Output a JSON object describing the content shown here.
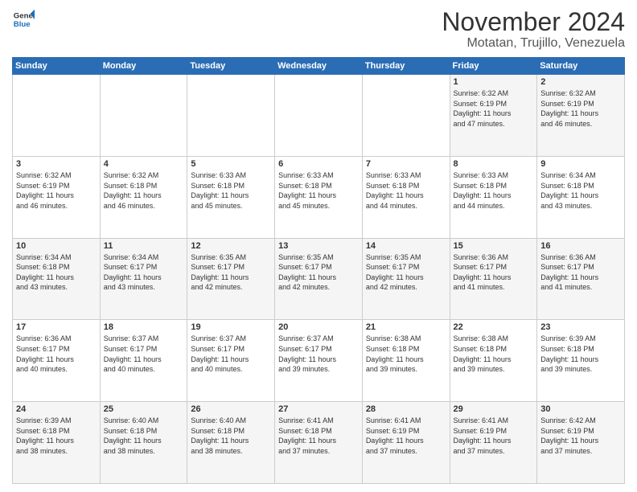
{
  "header": {
    "logo_general": "General",
    "logo_blue": "Blue",
    "title": "November 2024",
    "location": "Motatan, Trujillo, Venezuela"
  },
  "weekdays": [
    "Sunday",
    "Monday",
    "Tuesday",
    "Wednesday",
    "Thursday",
    "Friday",
    "Saturday"
  ],
  "weeks": [
    [
      {
        "day": "",
        "info": ""
      },
      {
        "day": "",
        "info": ""
      },
      {
        "day": "",
        "info": ""
      },
      {
        "day": "",
        "info": ""
      },
      {
        "day": "",
        "info": ""
      },
      {
        "day": "1",
        "info": "Sunrise: 6:32 AM\nSunset: 6:19 PM\nDaylight: 11 hours\nand 47 minutes."
      },
      {
        "day": "2",
        "info": "Sunrise: 6:32 AM\nSunset: 6:19 PM\nDaylight: 11 hours\nand 46 minutes."
      }
    ],
    [
      {
        "day": "3",
        "info": "Sunrise: 6:32 AM\nSunset: 6:19 PM\nDaylight: 11 hours\nand 46 minutes."
      },
      {
        "day": "4",
        "info": "Sunrise: 6:32 AM\nSunset: 6:18 PM\nDaylight: 11 hours\nand 46 minutes."
      },
      {
        "day": "5",
        "info": "Sunrise: 6:33 AM\nSunset: 6:18 PM\nDaylight: 11 hours\nand 45 minutes."
      },
      {
        "day": "6",
        "info": "Sunrise: 6:33 AM\nSunset: 6:18 PM\nDaylight: 11 hours\nand 45 minutes."
      },
      {
        "day": "7",
        "info": "Sunrise: 6:33 AM\nSunset: 6:18 PM\nDaylight: 11 hours\nand 44 minutes."
      },
      {
        "day": "8",
        "info": "Sunrise: 6:33 AM\nSunset: 6:18 PM\nDaylight: 11 hours\nand 44 minutes."
      },
      {
        "day": "9",
        "info": "Sunrise: 6:34 AM\nSunset: 6:18 PM\nDaylight: 11 hours\nand 43 minutes."
      }
    ],
    [
      {
        "day": "10",
        "info": "Sunrise: 6:34 AM\nSunset: 6:18 PM\nDaylight: 11 hours\nand 43 minutes."
      },
      {
        "day": "11",
        "info": "Sunrise: 6:34 AM\nSunset: 6:17 PM\nDaylight: 11 hours\nand 43 minutes."
      },
      {
        "day": "12",
        "info": "Sunrise: 6:35 AM\nSunset: 6:17 PM\nDaylight: 11 hours\nand 42 minutes."
      },
      {
        "day": "13",
        "info": "Sunrise: 6:35 AM\nSunset: 6:17 PM\nDaylight: 11 hours\nand 42 minutes."
      },
      {
        "day": "14",
        "info": "Sunrise: 6:35 AM\nSunset: 6:17 PM\nDaylight: 11 hours\nand 42 minutes."
      },
      {
        "day": "15",
        "info": "Sunrise: 6:36 AM\nSunset: 6:17 PM\nDaylight: 11 hours\nand 41 minutes."
      },
      {
        "day": "16",
        "info": "Sunrise: 6:36 AM\nSunset: 6:17 PM\nDaylight: 11 hours\nand 41 minutes."
      }
    ],
    [
      {
        "day": "17",
        "info": "Sunrise: 6:36 AM\nSunset: 6:17 PM\nDaylight: 11 hours\nand 40 minutes."
      },
      {
        "day": "18",
        "info": "Sunrise: 6:37 AM\nSunset: 6:17 PM\nDaylight: 11 hours\nand 40 minutes."
      },
      {
        "day": "19",
        "info": "Sunrise: 6:37 AM\nSunset: 6:17 PM\nDaylight: 11 hours\nand 40 minutes."
      },
      {
        "day": "20",
        "info": "Sunrise: 6:37 AM\nSunset: 6:17 PM\nDaylight: 11 hours\nand 39 minutes."
      },
      {
        "day": "21",
        "info": "Sunrise: 6:38 AM\nSunset: 6:18 PM\nDaylight: 11 hours\nand 39 minutes."
      },
      {
        "day": "22",
        "info": "Sunrise: 6:38 AM\nSunset: 6:18 PM\nDaylight: 11 hours\nand 39 minutes."
      },
      {
        "day": "23",
        "info": "Sunrise: 6:39 AM\nSunset: 6:18 PM\nDaylight: 11 hours\nand 39 minutes."
      }
    ],
    [
      {
        "day": "24",
        "info": "Sunrise: 6:39 AM\nSunset: 6:18 PM\nDaylight: 11 hours\nand 38 minutes."
      },
      {
        "day": "25",
        "info": "Sunrise: 6:40 AM\nSunset: 6:18 PM\nDaylight: 11 hours\nand 38 minutes."
      },
      {
        "day": "26",
        "info": "Sunrise: 6:40 AM\nSunset: 6:18 PM\nDaylight: 11 hours\nand 38 minutes."
      },
      {
        "day": "27",
        "info": "Sunrise: 6:41 AM\nSunset: 6:18 PM\nDaylight: 11 hours\nand 37 minutes."
      },
      {
        "day": "28",
        "info": "Sunrise: 6:41 AM\nSunset: 6:19 PM\nDaylight: 11 hours\nand 37 minutes."
      },
      {
        "day": "29",
        "info": "Sunrise: 6:41 AM\nSunset: 6:19 PM\nDaylight: 11 hours\nand 37 minutes."
      },
      {
        "day": "30",
        "info": "Sunrise: 6:42 AM\nSunset: 6:19 PM\nDaylight: 11 hours\nand 37 minutes."
      }
    ]
  ]
}
